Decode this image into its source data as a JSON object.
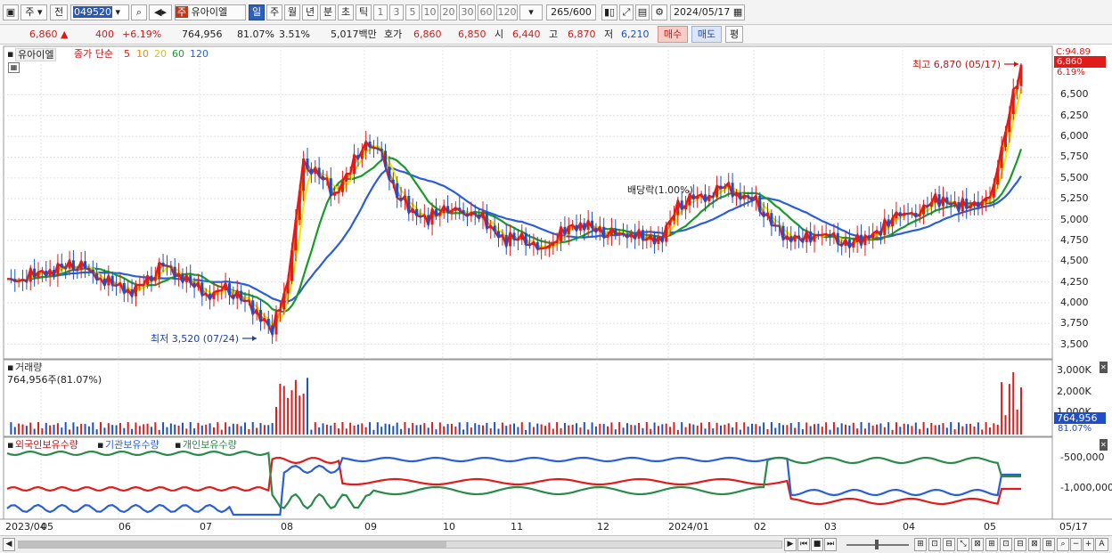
{
  "toolbar": {
    "period_type": "주",
    "prev_label": "전",
    "stock_code": "049520",
    "stock_badge": "주",
    "stock_name": "유아이엘",
    "period_buttons": [
      "일",
      "주",
      "월",
      "년",
      "분",
      "초",
      "틱"
    ],
    "selected_period": "일",
    "interval_buttons": [
      "1",
      "3",
      "5",
      "10",
      "20",
      "30",
      "60",
      "120"
    ],
    "count_value": "265",
    "count_total": "/600",
    "date_value": "2024/05/17"
  },
  "quote": {
    "price": "6,860",
    "change": "400",
    "change_rate": "+6.19%",
    "volume": "764,956",
    "volume_ratio": "81.07%",
    "turnover": "3.51%",
    "amount": "5,017백만",
    "hoga_label": "호가",
    "ask": "6,860",
    "bid": "6,850",
    "open_label": "시",
    "open": "6,440",
    "high_label": "고",
    "high": "6,870",
    "low_label": "저",
    "low": "6,210",
    "buy_label": "매수",
    "sell_label": "매도",
    "avg_label": "평"
  },
  "price_panel": {
    "stock_label": "유아이엘",
    "legend_prefix": "종가 단순",
    "ma_periods": [
      "5",
      "10",
      "20",
      "60",
      "120"
    ],
    "colors": {
      "ma5": "#e01b1b",
      "ma10": "#f08c00",
      "ma20": "#f2e600",
      "ma60": "#1a9a2a",
      "ma120": "#2a5fd8",
      "up": "#e01b1b",
      "down": "#1a4fd0"
    },
    "y_ticks": [
      "6,500",
      "6,250",
      "6,000",
      "5,750",
      "5,500",
      "5,250",
      "5,000",
      "4,750",
      "4,500",
      "4,250",
      "4,000",
      "3,750",
      "3,500"
    ],
    "c_ratio": "C:94.89",
    "last_price_badge": "6,860",
    "last_change_badge": "6.19%",
    "high_annotation": "최고 6,870 (05/17)",
    "low_annotation": "최저 3,520 (07/24)",
    "dividend_annotation": "배당락(1.00%)"
  },
  "volume_panel": {
    "title": "거래량",
    "value_text": "764,956주(81.07%)",
    "y_ticks": [
      "3,000K",
      "2,000K",
      "1,000K"
    ],
    "badge_value": "764,956",
    "badge_ratio": "81.07%"
  },
  "holdings_panel": {
    "legend": [
      "외국인보유수량",
      "기관보유수량",
      "개인보유수량"
    ],
    "colors": {
      "foreign": "#e01b1b",
      "institution": "#2a5fd8",
      "individual": "#2a8a4a"
    },
    "y_ticks": [
      "-500,000",
      "-1,000,000"
    ]
  },
  "x_axis": {
    "labels": [
      "2023/04",
      "05",
      "06",
      "07",
      "08",
      "09",
      "10",
      "11",
      "12",
      "2024/01",
      "02",
      "03",
      "04",
      "05"
    ],
    "right_label": "05/17"
  },
  "chart_data": {
    "type": "candlestick",
    "title": "유아이엘",
    "y_range": [
      3400,
      6900
    ],
    "high": 6870,
    "low": 3520,
    "last_close": 6860,
    "weekly_close": [
      4250,
      4300,
      4350,
      4400,
      4450,
      4400,
      4300,
      4200,
      4150,
      4250,
      4450,
      4350,
      4200,
      4100,
      4150,
      4050,
      3900,
      3650,
      4300,
      5650,
      5550,
      5300,
      5600,
      5950,
      5750,
      5300,
      5100,
      5000,
      5150,
      5050,
      5100,
      4900,
      4750,
      4800,
      4600,
      4750,
      4900,
      4950,
      4850,
      4800,
      4850,
      4750,
      4800,
      5150,
      5250,
      5300,
      5400,
      5300,
      5200,
      4950,
      4800,
      4750,
      4850,
      4750,
      4700,
      4800,
      4850,
      5100,
      5000,
      5200,
      5250,
      5150,
      5200,
      5200,
      6100,
      6860
    ]
  },
  "bottom_bar": {
    "buttons": [
      "▶",
      "⏮",
      "■",
      "⏭",
      "−",
      "+",
      "A"
    ]
  }
}
